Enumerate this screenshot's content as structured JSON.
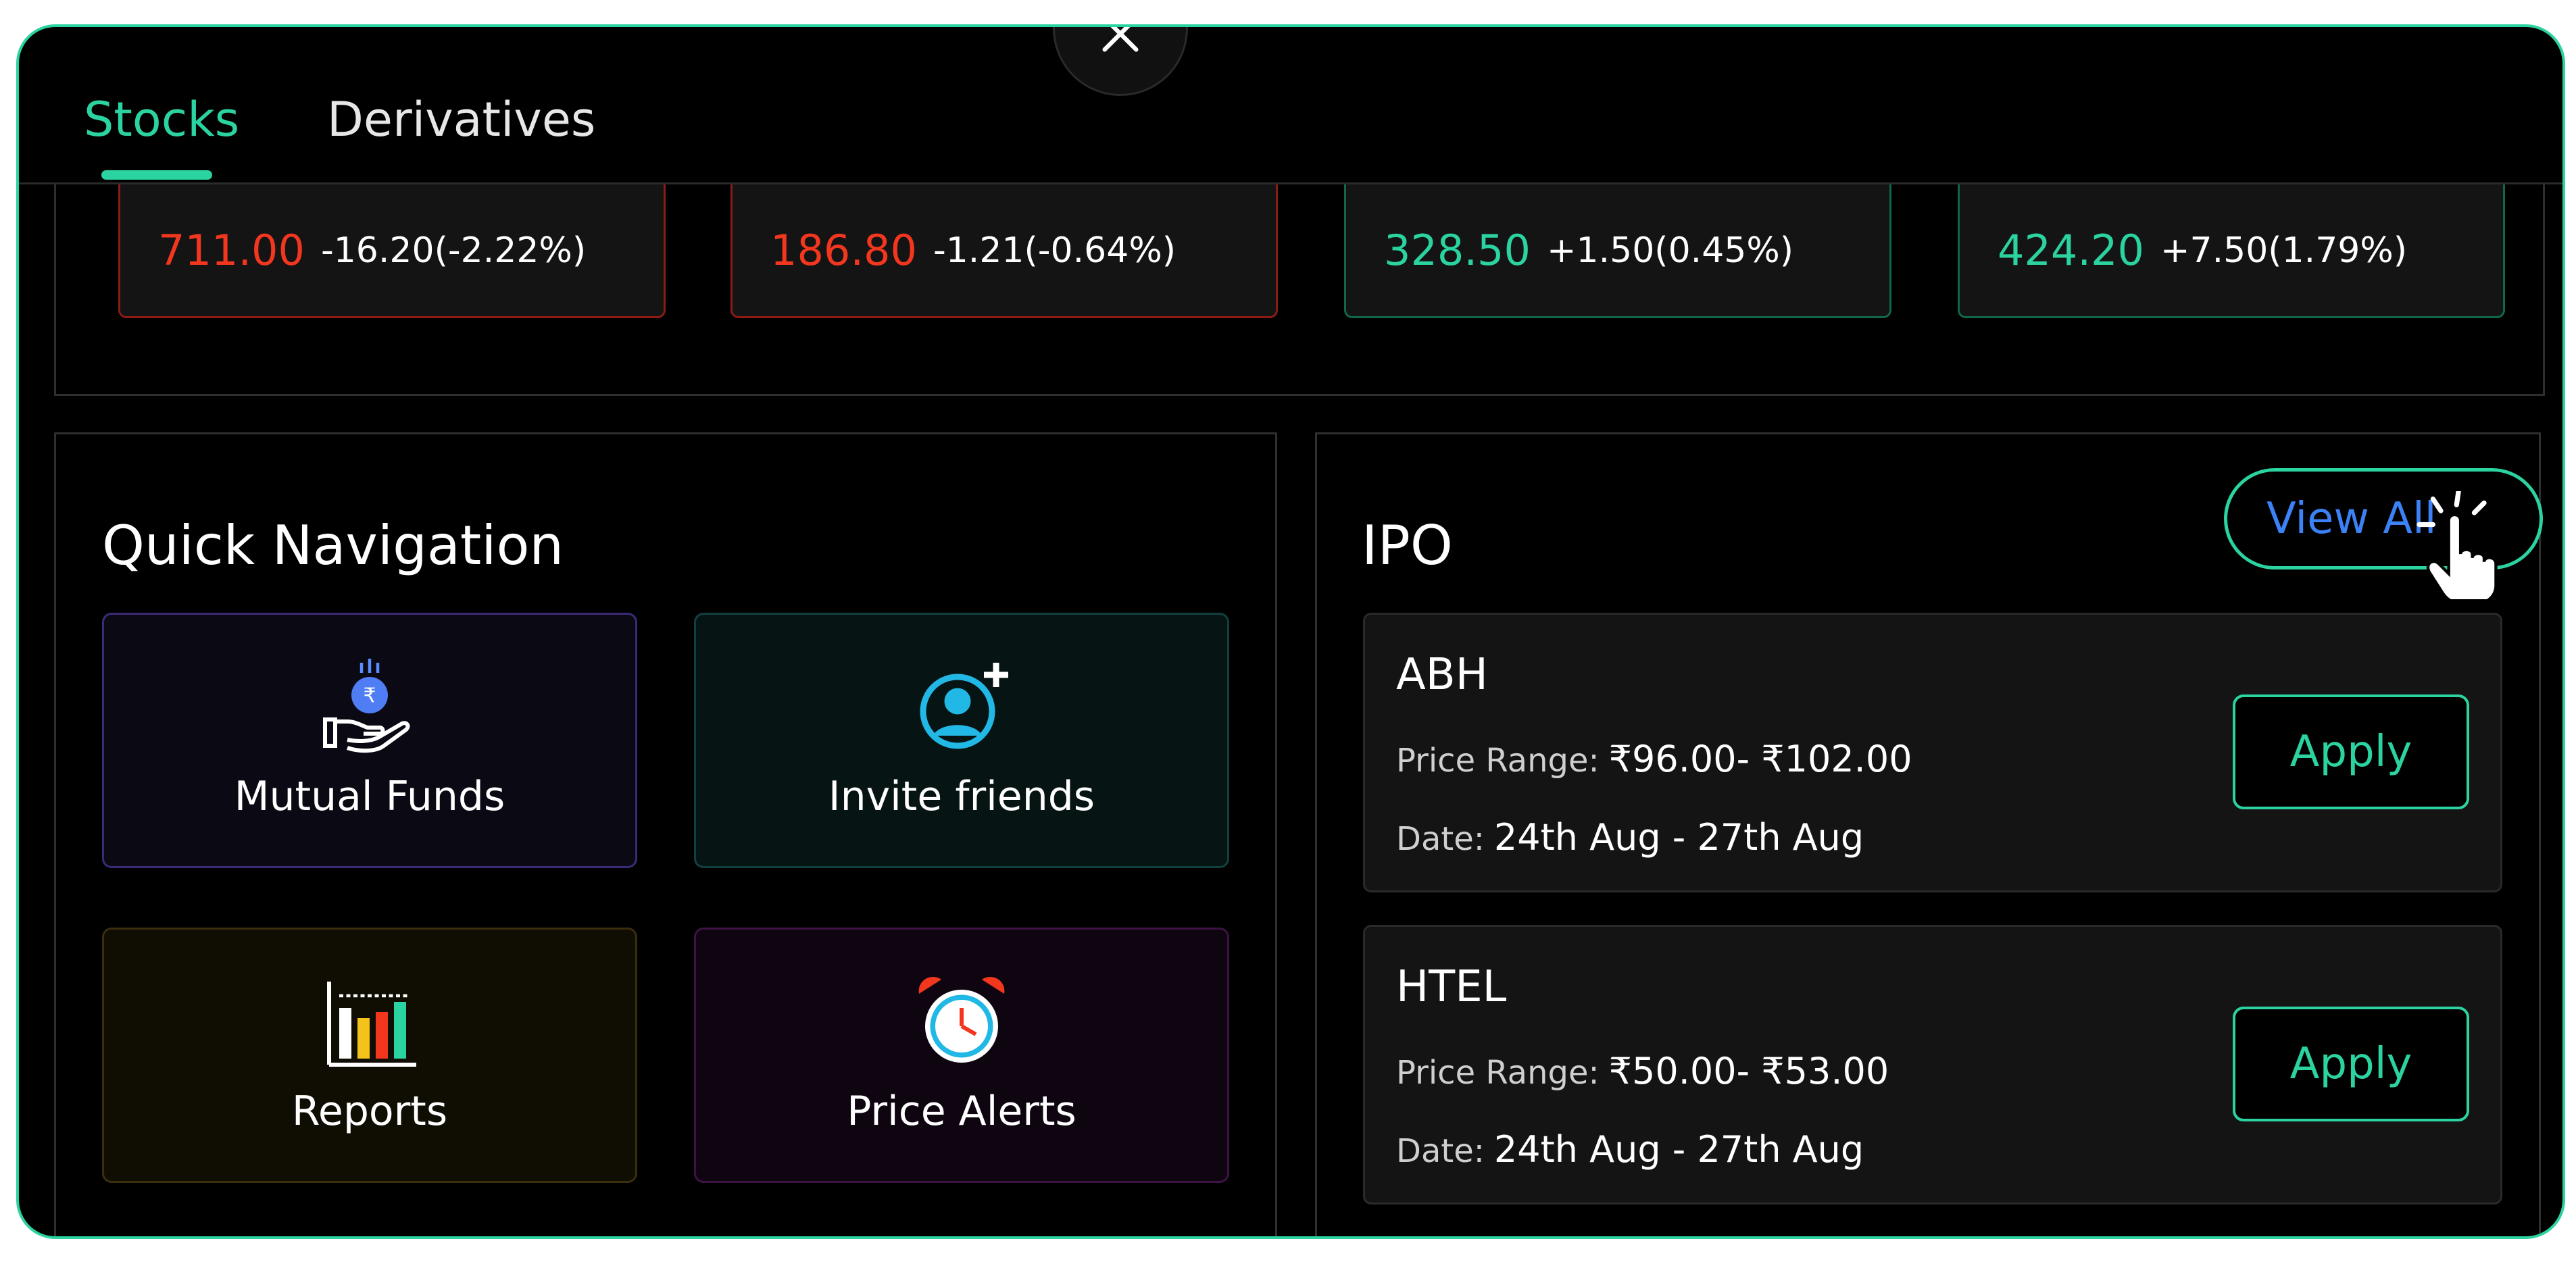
{
  "tabs": [
    {
      "label": "Stocks",
      "active": true
    },
    {
      "label": "Derivatives",
      "active": false
    }
  ],
  "tickers": [
    {
      "price": "711.00",
      "change": "-16.20(-2.22%)",
      "direction": "down"
    },
    {
      "price": "186.80",
      "change": "-1.21(-0.64%)",
      "direction": "down"
    },
    {
      "price": "328.50",
      "change": "+1.50(0.45%)",
      "direction": "up"
    },
    {
      "price": "424.20",
      "change": "+7.50(1.79%)",
      "direction": "up"
    }
  ],
  "quick_navigation": {
    "title": "Quick Navigation",
    "items": [
      {
        "label": "Mutual Funds",
        "icon": "rupee-hand-icon"
      },
      {
        "label": "Invite friends",
        "icon": "add-user-icon"
      },
      {
        "label": "Reports",
        "icon": "bar-report-icon"
      },
      {
        "label": "Price Alerts",
        "icon": "alarm-clock-icon"
      }
    ]
  },
  "ipo": {
    "title": "IPO",
    "view_all_label": "View All",
    "price_range_label": "Price Range:",
    "date_label": "Date:",
    "apply_label": "Apply",
    "items": [
      {
        "name": "ABH",
        "price_range": "₹96.00- ₹102.00",
        "date": "24th Aug - 27th Aug"
      },
      {
        "name": "HTEL",
        "price_range": "₹50.00- ₹53.00",
        "date": "24th Aug - 27th Aug"
      }
    ]
  },
  "colors": {
    "accent": "#2bd3a0",
    "down": "#f3371f",
    "link": "#3b82f6",
    "background": "#000000"
  }
}
